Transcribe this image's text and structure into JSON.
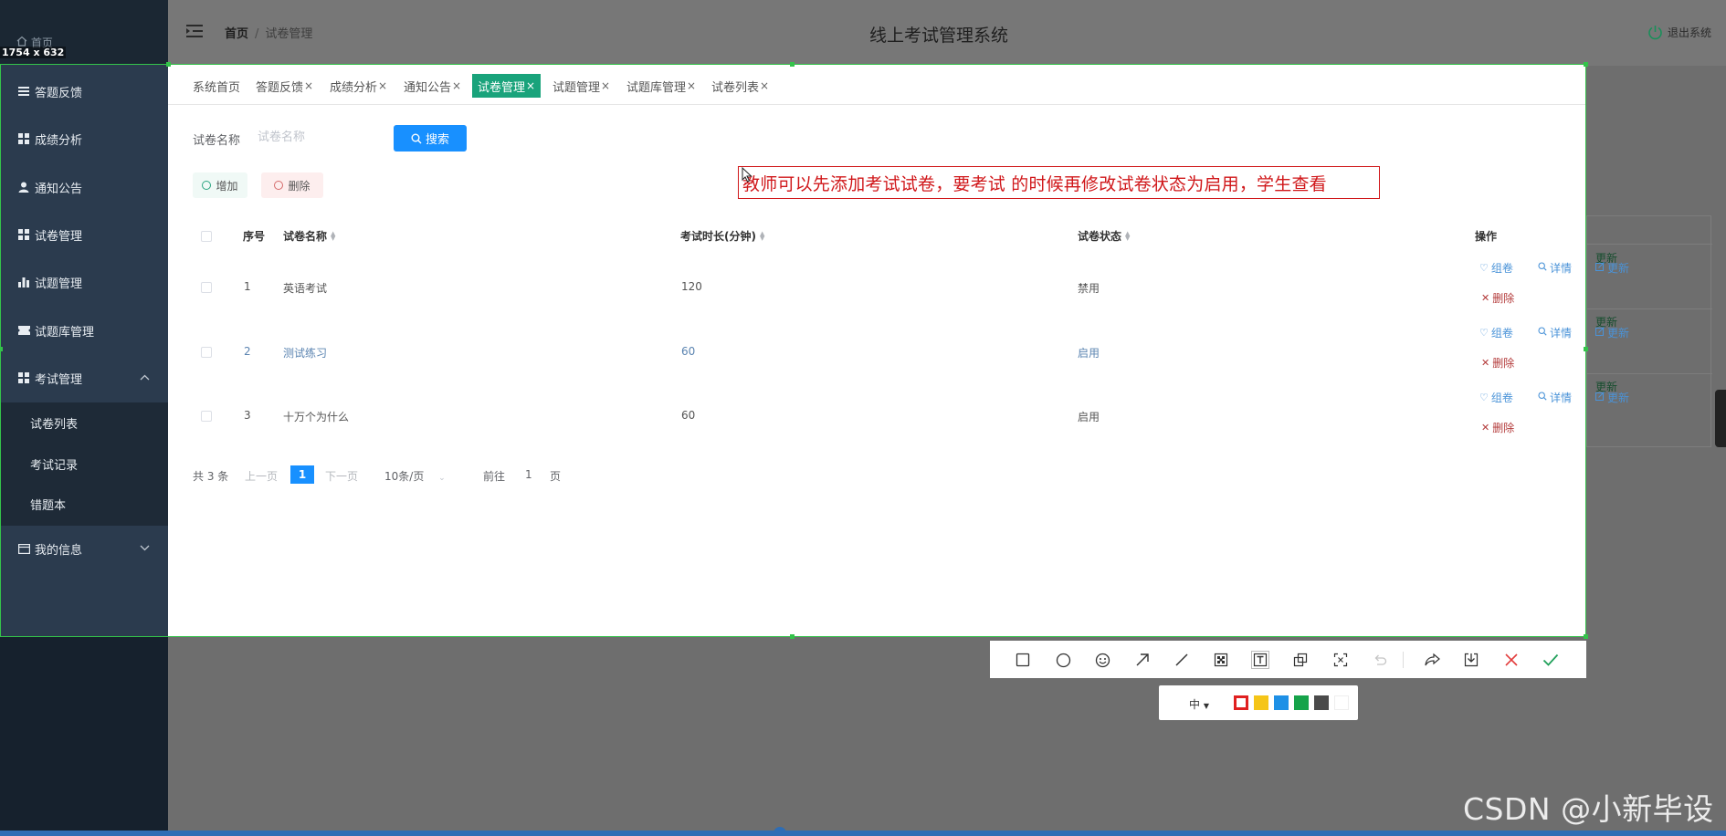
{
  "sidebar": {
    "home_label": "首页",
    "selection_size": "1754 x 632",
    "items": [
      {
        "label": "答题反馈",
        "icon": "list-icon"
      },
      {
        "label": "成绩分析",
        "icon": "grid-icon"
      },
      {
        "label": "通知公告",
        "icon": "user-icon"
      },
      {
        "label": "试卷管理",
        "icon": "grid-icon"
      },
      {
        "label": "试题管理",
        "icon": "bar-chart-icon"
      },
      {
        "label": "试题库管理",
        "icon": "ticket-icon"
      },
      {
        "label": "考试管理",
        "icon": "grid-icon"
      }
    ],
    "submenu": [
      "试卷列表",
      "考试记录",
      "错题本"
    ],
    "my_info": "我的信息"
  },
  "header": {
    "breadcrumb_home": "首页",
    "breadcrumb_sep": "/",
    "breadcrumb_current": "试卷管理",
    "title": "线上考试管理系统",
    "logout": "退出系统"
  },
  "tabs": [
    {
      "label": "系统首页",
      "closable": false
    },
    {
      "label": "答题反馈",
      "closable": true
    },
    {
      "label": "成绩分析",
      "closable": true
    },
    {
      "label": "通知公告",
      "closable": true
    },
    {
      "label": "试卷管理",
      "closable": true,
      "active": true
    },
    {
      "label": "试题管理",
      "closable": true
    },
    {
      "label": "试题库管理",
      "closable": true
    },
    {
      "label": "试卷列表",
      "closable": true
    }
  ],
  "tab_close": "×",
  "search": {
    "label": "试卷名称",
    "placeholder": "试卷名称",
    "value": "",
    "button": "搜索"
  },
  "actions": {
    "add": "增加",
    "delete": "删除"
  },
  "annotation": "教师可以先添加考试试卷，要考试 的时候再修改试卷状态为启用，学生查看",
  "table": {
    "headers": {
      "index": "序号",
      "name": "试卷名称",
      "duration": "考试时长(分钟)",
      "status": "试卷状态",
      "ops": "操作"
    },
    "rows": [
      {
        "index": "1",
        "name": "英语考试",
        "duration": "120",
        "status": "禁用"
      },
      {
        "index": "2",
        "name": "测试练习",
        "duration": "60",
        "status": "启用"
      },
      {
        "index": "3",
        "name": "十万个为什么",
        "duration": "60",
        "status": "启用"
      }
    ],
    "row_actions": {
      "compose": "组卷",
      "detail": "详情",
      "update": "更新",
      "delete": "删除"
    }
  },
  "pagination": {
    "total": "共 3 条",
    "prev": "上一页",
    "current": "1",
    "next": "下一页",
    "page_size": "10条/页",
    "goto_prefix": "前往",
    "goto_value": "1",
    "goto_suffix": "页"
  },
  "screenshot_tool": {
    "tools": [
      "rectangle-icon",
      "ellipse-icon",
      "emoji-icon",
      "arrow-icon",
      "line-icon",
      "mosaic-icon",
      "text-icon",
      "pin-icon",
      "ocr-icon",
      "undo-icon",
      "share-icon",
      "save-icon",
      "cancel-icon",
      "confirm-icon"
    ],
    "font_size": "中",
    "colors": [
      "#e02020",
      "#f5c518",
      "#1e90e6",
      "#16a34a",
      "#4a4a4a",
      "#ffffff"
    ],
    "selected_color": "#e02020"
  },
  "watermark": "CSDN @小新毕设"
}
